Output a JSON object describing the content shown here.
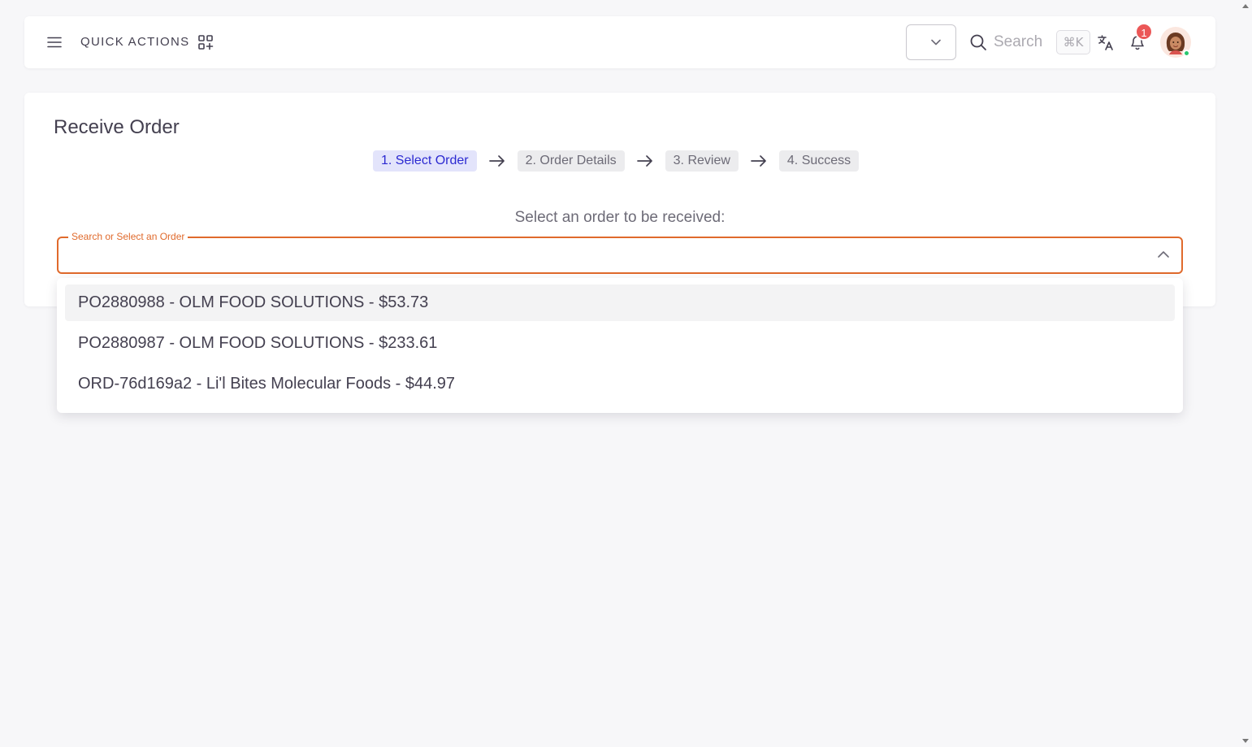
{
  "header": {
    "quick_actions_label": "QUICK ACTIONS",
    "search_label": "Search",
    "search_shortcut": "⌘K",
    "notification_count": "1",
    "icons": {
      "menu": "menu-icon",
      "quick_actions": "grid-plus-icon",
      "dropdown": "chevron-down-icon",
      "search": "search-icon",
      "translate": "translate-icon",
      "notifications": "bell-icon",
      "avatar": "user-avatar"
    }
  },
  "page": {
    "title": "Receive Order",
    "steps": [
      {
        "label": "1. Select Order",
        "active": true
      },
      {
        "label": "2. Order Details",
        "active": false
      },
      {
        "label": "3. Review",
        "active": false
      },
      {
        "label": "4. Success",
        "active": false
      }
    ],
    "instruction": "Select an order to be received:",
    "order_field": {
      "label": "Search or Select an Order",
      "value": ""
    },
    "order_options": [
      "PO2880988 - OLM FOOD SOLUTIONS - $53.73",
      "PO2880987 - OLM FOOD SOLUTIONS - $233.61",
      "ORD-76d169a2 - Li'l Bites Molecular Foods - $44.97"
    ]
  },
  "colors": {
    "accent": "#e06a2c",
    "active_step_bg": "#e3e4fb",
    "active_step_text": "#2c2ad1",
    "badge": "#eb5757",
    "online_status": "#28c76f"
  }
}
